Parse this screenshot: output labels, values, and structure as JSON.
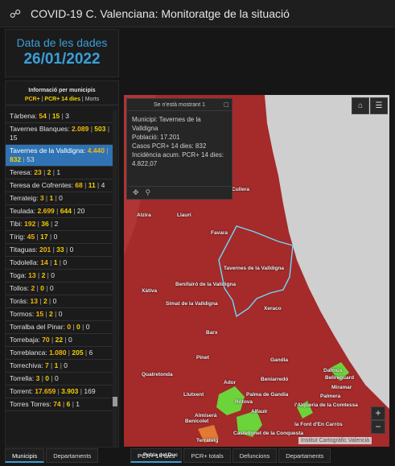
{
  "app": {
    "title": "COVID-19 C. Valenciana: Monitoratge de la situació"
  },
  "date_panel": {
    "title": "Data de les dades",
    "value": "26/01/2022"
  },
  "list": {
    "title": "Informació per municipis",
    "legend": {
      "pcr": "PCR+",
      "sep1": " | ",
      "pcr14": "PCR+ 14 dies",
      "sep2": " | ",
      "morts": "Morts"
    },
    "rows": [
      {
        "name": "Tàrbena:",
        "v1": "54",
        "v2": "15",
        "v3": "3"
      },
      {
        "name": "Tavernes Blanques:",
        "v1": "2.089",
        "v2": "503",
        "v3": "15"
      },
      {
        "name": "Tavernes de la Valldigna:",
        "v1": "4.440",
        "v2": "832",
        "v3": "53",
        "selected": true
      },
      {
        "name": "Teresa:",
        "v1": "23",
        "v2": "2",
        "v3": "1"
      },
      {
        "name": "Teresa de Cofrentes:",
        "v1": "68",
        "v2": "11",
        "v3": "4"
      },
      {
        "name": "Terrateig:",
        "v1": "3",
        "v2": "1",
        "v3": "0"
      },
      {
        "name": "Teulada:",
        "v1": "2.699",
        "v2": "644",
        "v3": "20"
      },
      {
        "name": "Tibi:",
        "v1": "192",
        "v2": "36",
        "v3": "2"
      },
      {
        "name": "Tírig:",
        "v1": "45",
        "v2": "17",
        "v3": "0"
      },
      {
        "name": "Titaguas:",
        "v1": "201",
        "v2": "33",
        "v3": "0"
      },
      {
        "name": "Todolella:",
        "v1": "14",
        "v2": "1",
        "v3": "0"
      },
      {
        "name": "Toga:",
        "v1": "13",
        "v2": "2",
        "v3": "0"
      },
      {
        "name": "Tollos:",
        "v1": "2",
        "v2": "0",
        "v3": "0"
      },
      {
        "name": "Torás:",
        "v1": "13",
        "v2": "2",
        "v3": "0"
      },
      {
        "name": "Tormos:",
        "v1": "15",
        "v2": "2",
        "v3": "0"
      },
      {
        "name": "Torralba del Pinar:",
        "v1": "0",
        "v2": "0",
        "v3": "0"
      },
      {
        "name": "Torrebaja:",
        "v1": "70",
        "v2": "22",
        "v3": "0"
      },
      {
        "name": "Torreblanca:",
        "v1": "1.080",
        "v2": "205",
        "v3": "6"
      },
      {
        "name": "Torrechiva:",
        "v1": "7",
        "v2": "1",
        "v3": "0"
      },
      {
        "name": "Torrella:",
        "v1": "3",
        "v2": "0",
        "v3": "0"
      },
      {
        "name": "Torrent:",
        "v1": "17.659",
        "v2": "3.903",
        "v3": "169"
      },
      {
        "name": "Torres Torres:",
        "v1": "74",
        "v2": "6",
        "v3": "1"
      }
    ]
  },
  "popup": {
    "header": "Se n'està mostrant 1",
    "close": "□",
    "lines": [
      "Municipi: Tavernes de la Valldigna",
      "Població: 17.201",
      "Casos PCR+ 14 dies: 832",
      "Incidència acum. PCR+ 14 dies: 4.822,07"
    ]
  },
  "map": {
    "attribution": "Institut Cartogràfic Valencià",
    "colors": {
      "sea": "#cfcfcf",
      "high": "#a52a2a",
      "mid": "#b03535",
      "low": "#6bd43b",
      "orange": "#e07a35",
      "selected_outline": "#6ad9ff"
    },
    "towns": [
      "Cullera",
      "Alzira",
      "Llaurí",
      "Favara",
      "Tavernes de la Valldigna",
      "Benifairó de la Valldigna",
      "Xàtiva",
      "Simat de la Valldigna",
      "Xeraco",
      "Barx",
      "Gandia",
      "Pinet",
      "Quatretonda",
      "Ador",
      "Beniarredó",
      "Daimús",
      "Bellreguard",
      "Miramar",
      "Palma de Gandia",
      "Palmera",
      "Llutxent",
      "Ròtova",
      "l'Alqueria de la Comtessa",
      "Almiserà",
      "Alfauir",
      "Benicolet",
      "Castellonet de la Conquesta",
      "la Font d'En Carròs",
      "Terrateig",
      "Pobla del Duc"
    ]
  },
  "tabs_left": [
    {
      "label": "Municipis",
      "active": true
    },
    {
      "label": "Departaments",
      "active": false
    }
  ],
  "tabs_right": [
    {
      "label": "PCR+ 14 dies",
      "active": true
    },
    {
      "label": "PCR+ totals",
      "active": false
    },
    {
      "label": "Defuncions",
      "active": false
    },
    {
      "label": "Departaments",
      "active": false
    }
  ]
}
